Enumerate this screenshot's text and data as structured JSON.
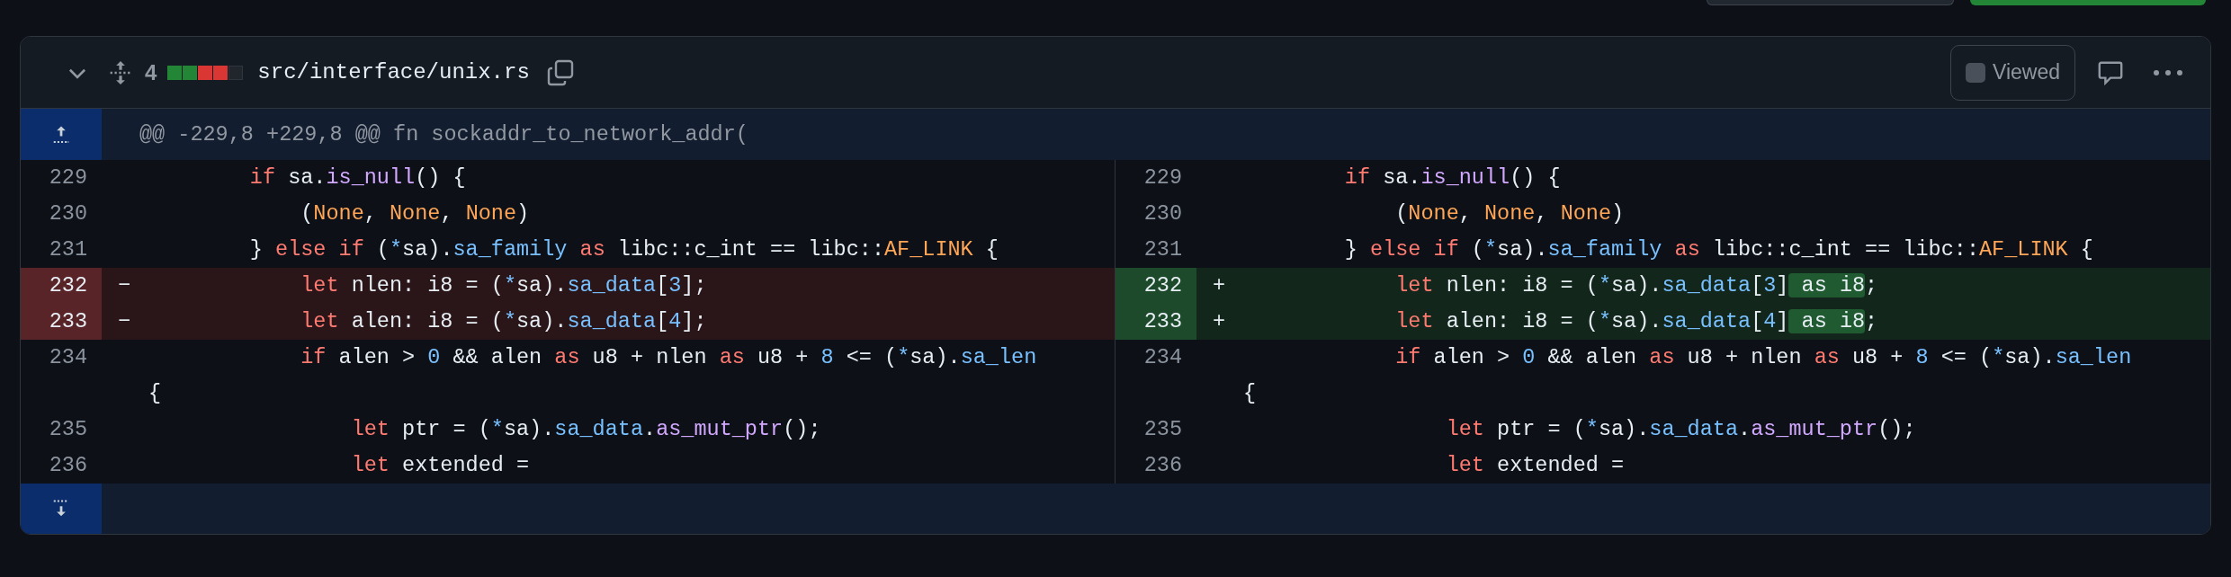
{
  "file_header": {
    "expanded": true,
    "changes": "4",
    "diff_stat": [
      {
        "kind": "added"
      },
      {
        "kind": "added"
      },
      {
        "kind": "deleted"
      },
      {
        "kind": "deleted"
      },
      {
        "kind": "neutral"
      }
    ],
    "path": "src/interface/unix.rs",
    "viewed": {
      "label": "Viewed",
      "checked": false
    }
  },
  "hunk_header": "@@ -229,8 +229,8 @@ fn sockaddr_to_network_addr(",
  "rows": [
    {
      "left": {
        "number": "229",
        "kind": "context",
        "tokens": [
          {
            "kw": "        if"
          },
          {
            "plain": " sa."
          },
          {
            "fn": "is_null"
          },
          {
            "plain": "() {"
          }
        ]
      },
      "right": {
        "number": "229",
        "kind": "context",
        "tokens": [
          {
            "kw": "        if"
          },
          {
            "plain": " sa."
          },
          {
            "fn": "is_null"
          },
          {
            "plain": "() {"
          }
        ]
      }
    },
    {
      "left": {
        "number": "230",
        "kind": "context",
        "tokens": [
          {
            "plain": "            ("
          },
          {
            "const": "None"
          },
          {
            "plain": ", "
          },
          {
            "const": "None"
          },
          {
            "plain": ", "
          },
          {
            "const": "None"
          },
          {
            "plain": ")"
          }
        ]
      },
      "right": {
        "number": "230",
        "kind": "context",
        "tokens": [
          {
            "plain": "            ("
          },
          {
            "const": "None"
          },
          {
            "plain": ", "
          },
          {
            "const": "None"
          },
          {
            "plain": ", "
          },
          {
            "const": "None"
          },
          {
            "plain": ")"
          }
        ]
      }
    },
    {
      "left": {
        "number": "231",
        "kind": "context",
        "tokens": [
          {
            "plain": "        } "
          },
          {
            "kw": "else if"
          },
          {
            "plain": " ("
          },
          {
            "prop": "*"
          },
          {
            "plain": "sa)."
          },
          {
            "prop": "sa_family"
          },
          {
            "kw": " as"
          },
          {
            "plain": " libc::c_int == libc::"
          },
          {
            "const": "AF_LINK"
          },
          {
            "plain": " {"
          }
        ]
      },
      "right": {
        "number": "231",
        "kind": "context",
        "tokens": [
          {
            "plain": "        } "
          },
          {
            "kw": "else if"
          },
          {
            "plain": " ("
          },
          {
            "prop": "*"
          },
          {
            "plain": "sa)."
          },
          {
            "prop": "sa_family"
          },
          {
            "kw": " as"
          },
          {
            "plain": " libc::c_int == libc::"
          },
          {
            "const": "AF_LINK"
          },
          {
            "plain": " {"
          }
        ]
      }
    },
    {
      "left": {
        "number": "232",
        "kind": "deleted",
        "marker": "−",
        "tokens": [
          {
            "kw": "            let"
          },
          {
            "plain": " nlen: i8 = ("
          },
          {
            "prop": "*"
          },
          {
            "plain": "sa)."
          },
          {
            "prop": "sa_data"
          },
          {
            "plain": "["
          },
          {
            "num": "3"
          },
          {
            "plain": "];"
          }
        ]
      },
      "right": {
        "number": "232",
        "kind": "added",
        "marker": "+",
        "tokens": [
          {
            "kw": "            let"
          },
          {
            "plain": " nlen: i8 = ("
          },
          {
            "prop": "*"
          },
          {
            "plain": "sa)."
          },
          {
            "prop": "sa_data"
          },
          {
            "plain": "["
          },
          {
            "num": "3"
          },
          {
            "plain": "]"
          },
          {
            "inserted": " as i8"
          },
          {
            "plain": ";"
          }
        ]
      }
    },
    {
      "left": {
        "number": "233",
        "kind": "deleted",
        "marker": "−",
        "tokens": [
          {
            "kw": "            let"
          },
          {
            "plain": " alen: i8 = ("
          },
          {
            "prop": "*"
          },
          {
            "plain": "sa)."
          },
          {
            "prop": "sa_data"
          },
          {
            "plain": "["
          },
          {
            "num": "4"
          },
          {
            "plain": "];"
          }
        ]
      },
      "right": {
        "number": "233",
        "kind": "added",
        "marker": "+",
        "tokens": [
          {
            "kw": "            let"
          },
          {
            "plain": " alen: i8 = ("
          },
          {
            "prop": "*"
          },
          {
            "plain": "sa)."
          },
          {
            "prop": "sa_data"
          },
          {
            "plain": "["
          },
          {
            "num": "4"
          },
          {
            "plain": "]"
          },
          {
            "inserted": " as i8"
          },
          {
            "plain": ";"
          }
        ]
      }
    },
    {
      "left": {
        "number": "234",
        "kind": "context",
        "tokens": [
          {
            "kw": "            if"
          },
          {
            "plain": " alen > "
          },
          {
            "num": "0"
          },
          {
            "plain": " && alen "
          },
          {
            "kw": "as"
          },
          {
            "plain": " u8 + nlen "
          },
          {
            "kw": "as"
          },
          {
            "plain": " u8 + "
          },
          {
            "num": "8"
          },
          {
            "plain": " <= ("
          },
          {
            "prop": "*"
          },
          {
            "plain": "sa)."
          },
          {
            "prop": "sa_len"
          }
        ],
        "wrap": [
          {
            "plain": "{"
          }
        ]
      },
      "right": {
        "number": "234",
        "kind": "context",
        "tokens": [
          {
            "kw": "            if"
          },
          {
            "plain": " alen > "
          },
          {
            "num": "0"
          },
          {
            "plain": " && alen "
          },
          {
            "kw": "as"
          },
          {
            "plain": " u8 + nlen "
          },
          {
            "kw": "as"
          },
          {
            "plain": " u8 + "
          },
          {
            "num": "8"
          },
          {
            "plain": " <= ("
          },
          {
            "prop": "*"
          },
          {
            "plain": "sa)."
          },
          {
            "prop": "sa_len"
          }
        ],
        "wrap": [
          {
            "plain": "{"
          }
        ]
      }
    },
    {
      "left": {
        "number": "235",
        "kind": "context",
        "tokens": [
          {
            "kw": "                let"
          },
          {
            "plain": " ptr = ("
          },
          {
            "prop": "*"
          },
          {
            "plain": "sa)."
          },
          {
            "prop": "sa_data"
          },
          {
            "plain": "."
          },
          {
            "fn": "as_mut_ptr"
          },
          {
            "plain": "();"
          }
        ]
      },
      "right": {
        "number": "235",
        "kind": "context",
        "tokens": [
          {
            "kw": "                let"
          },
          {
            "plain": " ptr = ("
          },
          {
            "prop": "*"
          },
          {
            "plain": "sa)."
          },
          {
            "prop": "sa_data"
          },
          {
            "plain": "."
          },
          {
            "fn": "as_mut_ptr"
          },
          {
            "plain": "();"
          }
        ]
      }
    },
    {
      "left": {
        "number": "236",
        "kind": "context",
        "tokens": [
          {
            "kw": "                let"
          },
          {
            "plain": " extended ="
          }
        ]
      },
      "right": {
        "number": "236",
        "kind": "context",
        "tokens": [
          {
            "kw": "                let"
          },
          {
            "plain": " extended ="
          }
        ]
      }
    }
  ]
}
